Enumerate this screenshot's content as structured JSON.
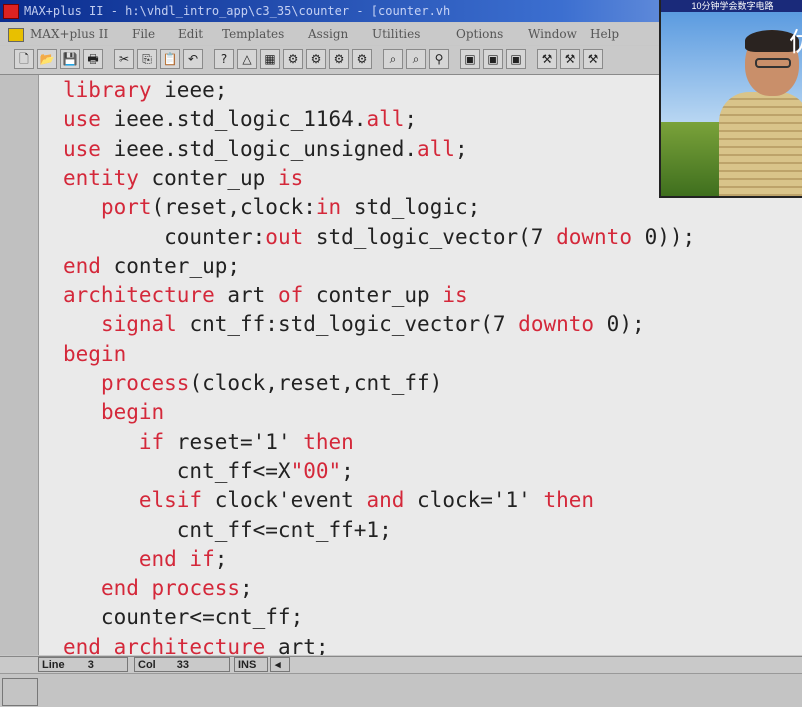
{
  "window": {
    "title": "MAX+plus II - h:\\vhdl_intro_app\\c3_35\\counter - [counter.vh"
  },
  "menu": {
    "items": [
      "MAX+plus II",
      "File",
      "Edit",
      "Templates",
      "Assign",
      "Utilities",
      "Options",
      "Window",
      "Help"
    ]
  },
  "toolbar": {
    "buttons": [
      {
        "name": "new-icon",
        "glyph": "🗋"
      },
      {
        "name": "open-icon",
        "glyph": "📂"
      },
      {
        "name": "save-icon",
        "glyph": "💾"
      },
      {
        "name": "print-icon",
        "glyph": "🖶"
      },
      {
        "name": "cut-icon",
        "glyph": "✂"
      },
      {
        "name": "copy-icon",
        "glyph": "⎘"
      },
      {
        "name": "paste-icon",
        "glyph": "📋"
      },
      {
        "name": "undo-icon",
        "glyph": "↶"
      },
      {
        "name": "help-pointer-icon",
        "glyph": "?"
      },
      {
        "name": "hierarchy-icon",
        "glyph": "△"
      },
      {
        "name": "floorplan-icon",
        "glyph": "▦"
      },
      {
        "name": "compiler-icon",
        "glyph": "⚙"
      },
      {
        "name": "simulator-icon",
        "glyph": "⚙"
      },
      {
        "name": "timing-icon",
        "glyph": "⚙"
      },
      {
        "name": "programmer-icon",
        "glyph": "⚙"
      },
      {
        "name": "find-icon",
        "glyph": "⌕"
      },
      {
        "name": "find-next-icon",
        "glyph": "⌕"
      },
      {
        "name": "tree-icon",
        "glyph": "⚲"
      },
      {
        "name": "project-save-icon",
        "glyph": "▣"
      },
      {
        "name": "project-compile-icon",
        "glyph": "▣"
      },
      {
        "name": "project-sim-icon",
        "glyph": "▣"
      },
      {
        "name": "tools-icon",
        "glyph": "⚒"
      },
      {
        "name": "tools2-icon",
        "glyph": "⚒"
      },
      {
        "name": "tools3-icon",
        "glyph": "⚒"
      }
    ]
  },
  "code": {
    "lines": [
      [
        {
          "t": "library",
          "k": true
        },
        {
          "t": " ieee;"
        }
      ],
      [
        {
          "t": "use",
          "k": true
        },
        {
          "t": " ieee.std_logic_1164."
        },
        {
          "t": "all",
          "k": true
        },
        {
          "t": ";"
        }
      ],
      [
        {
          "t": "use",
          "k": true
        },
        {
          "t": " ieee.std_logic_unsigned."
        },
        {
          "t": "all",
          "k": true
        },
        {
          "t": ";"
        }
      ],
      [
        {
          "t": "entity",
          "k": true
        },
        {
          "t": " conter_up "
        },
        {
          "t": "is",
          "k": true
        }
      ],
      [
        {
          "t": "   "
        },
        {
          "t": "port",
          "k": true
        },
        {
          "t": "(reset,clock:"
        },
        {
          "t": "in",
          "k": true
        },
        {
          "t": " std_logic;"
        }
      ],
      [
        {
          "t": "        counter:"
        },
        {
          "t": "out",
          "k": true
        },
        {
          "t": " std_logic_vector(7 "
        },
        {
          "t": "downto",
          "k": true
        },
        {
          "t": " 0));"
        }
      ],
      [
        {
          "t": "end",
          "k": true
        },
        {
          "t": " conter_up;"
        }
      ],
      [
        {
          "t": "architecture",
          "k": true
        },
        {
          "t": " art "
        },
        {
          "t": "of",
          "k": true
        },
        {
          "t": " conter_up "
        },
        {
          "t": "is",
          "k": true
        }
      ],
      [
        {
          "t": "   "
        },
        {
          "t": "signal",
          "k": true
        },
        {
          "t": " cnt_ff:std_logic_vector(7 "
        },
        {
          "t": "downto",
          "k": true
        },
        {
          "t": " 0);"
        }
      ],
      [
        {
          "t": "begin",
          "k": true
        }
      ],
      [
        {
          "t": "   "
        },
        {
          "t": "process",
          "k": true
        },
        {
          "t": "(clock,reset,cnt_ff)"
        }
      ],
      [
        {
          "t": "   "
        },
        {
          "t": "begin",
          "k": true
        }
      ],
      [
        {
          "t": "      "
        },
        {
          "t": "if",
          "k": true
        },
        {
          "t": " reset='1' "
        },
        {
          "t": "then",
          "k": true
        }
      ],
      [
        {
          "t": "         cnt_ff<=X"
        },
        {
          "t": "\"00\"",
          "k": true
        },
        {
          "t": ";"
        }
      ],
      [
        {
          "t": "      "
        },
        {
          "t": "elsif",
          "k": true
        },
        {
          "t": " clock'event "
        },
        {
          "t": "and",
          "k": true
        },
        {
          "t": " clock='1' "
        },
        {
          "t": "then",
          "k": true
        }
      ],
      [
        {
          "t": "         cnt_ff<=cnt_ff+1;"
        }
      ],
      [
        {
          "t": "      "
        },
        {
          "t": "end if",
          "k": true
        },
        {
          "t": ";"
        }
      ],
      [
        {
          "t": "   "
        },
        {
          "t": "end process",
          "k": true
        },
        {
          "t": ";"
        }
      ],
      [
        {
          "t": "   counter<=cnt_ff;"
        }
      ],
      [
        {
          "t": "end architecture",
          "k": true
        },
        {
          "t": " art;"
        }
      ]
    ]
  },
  "status": {
    "line_label": "Line",
    "line_value": "3",
    "col_label": "Col",
    "col_value": "33",
    "mode": "INS"
  },
  "video": {
    "banner": "10分钟学会数字电路",
    "overlay_char": "优"
  },
  "colors": {
    "keyword": "#d4283a",
    "editor_bg": "#eaeaea",
    "title_bg": "#0a2c8e"
  }
}
